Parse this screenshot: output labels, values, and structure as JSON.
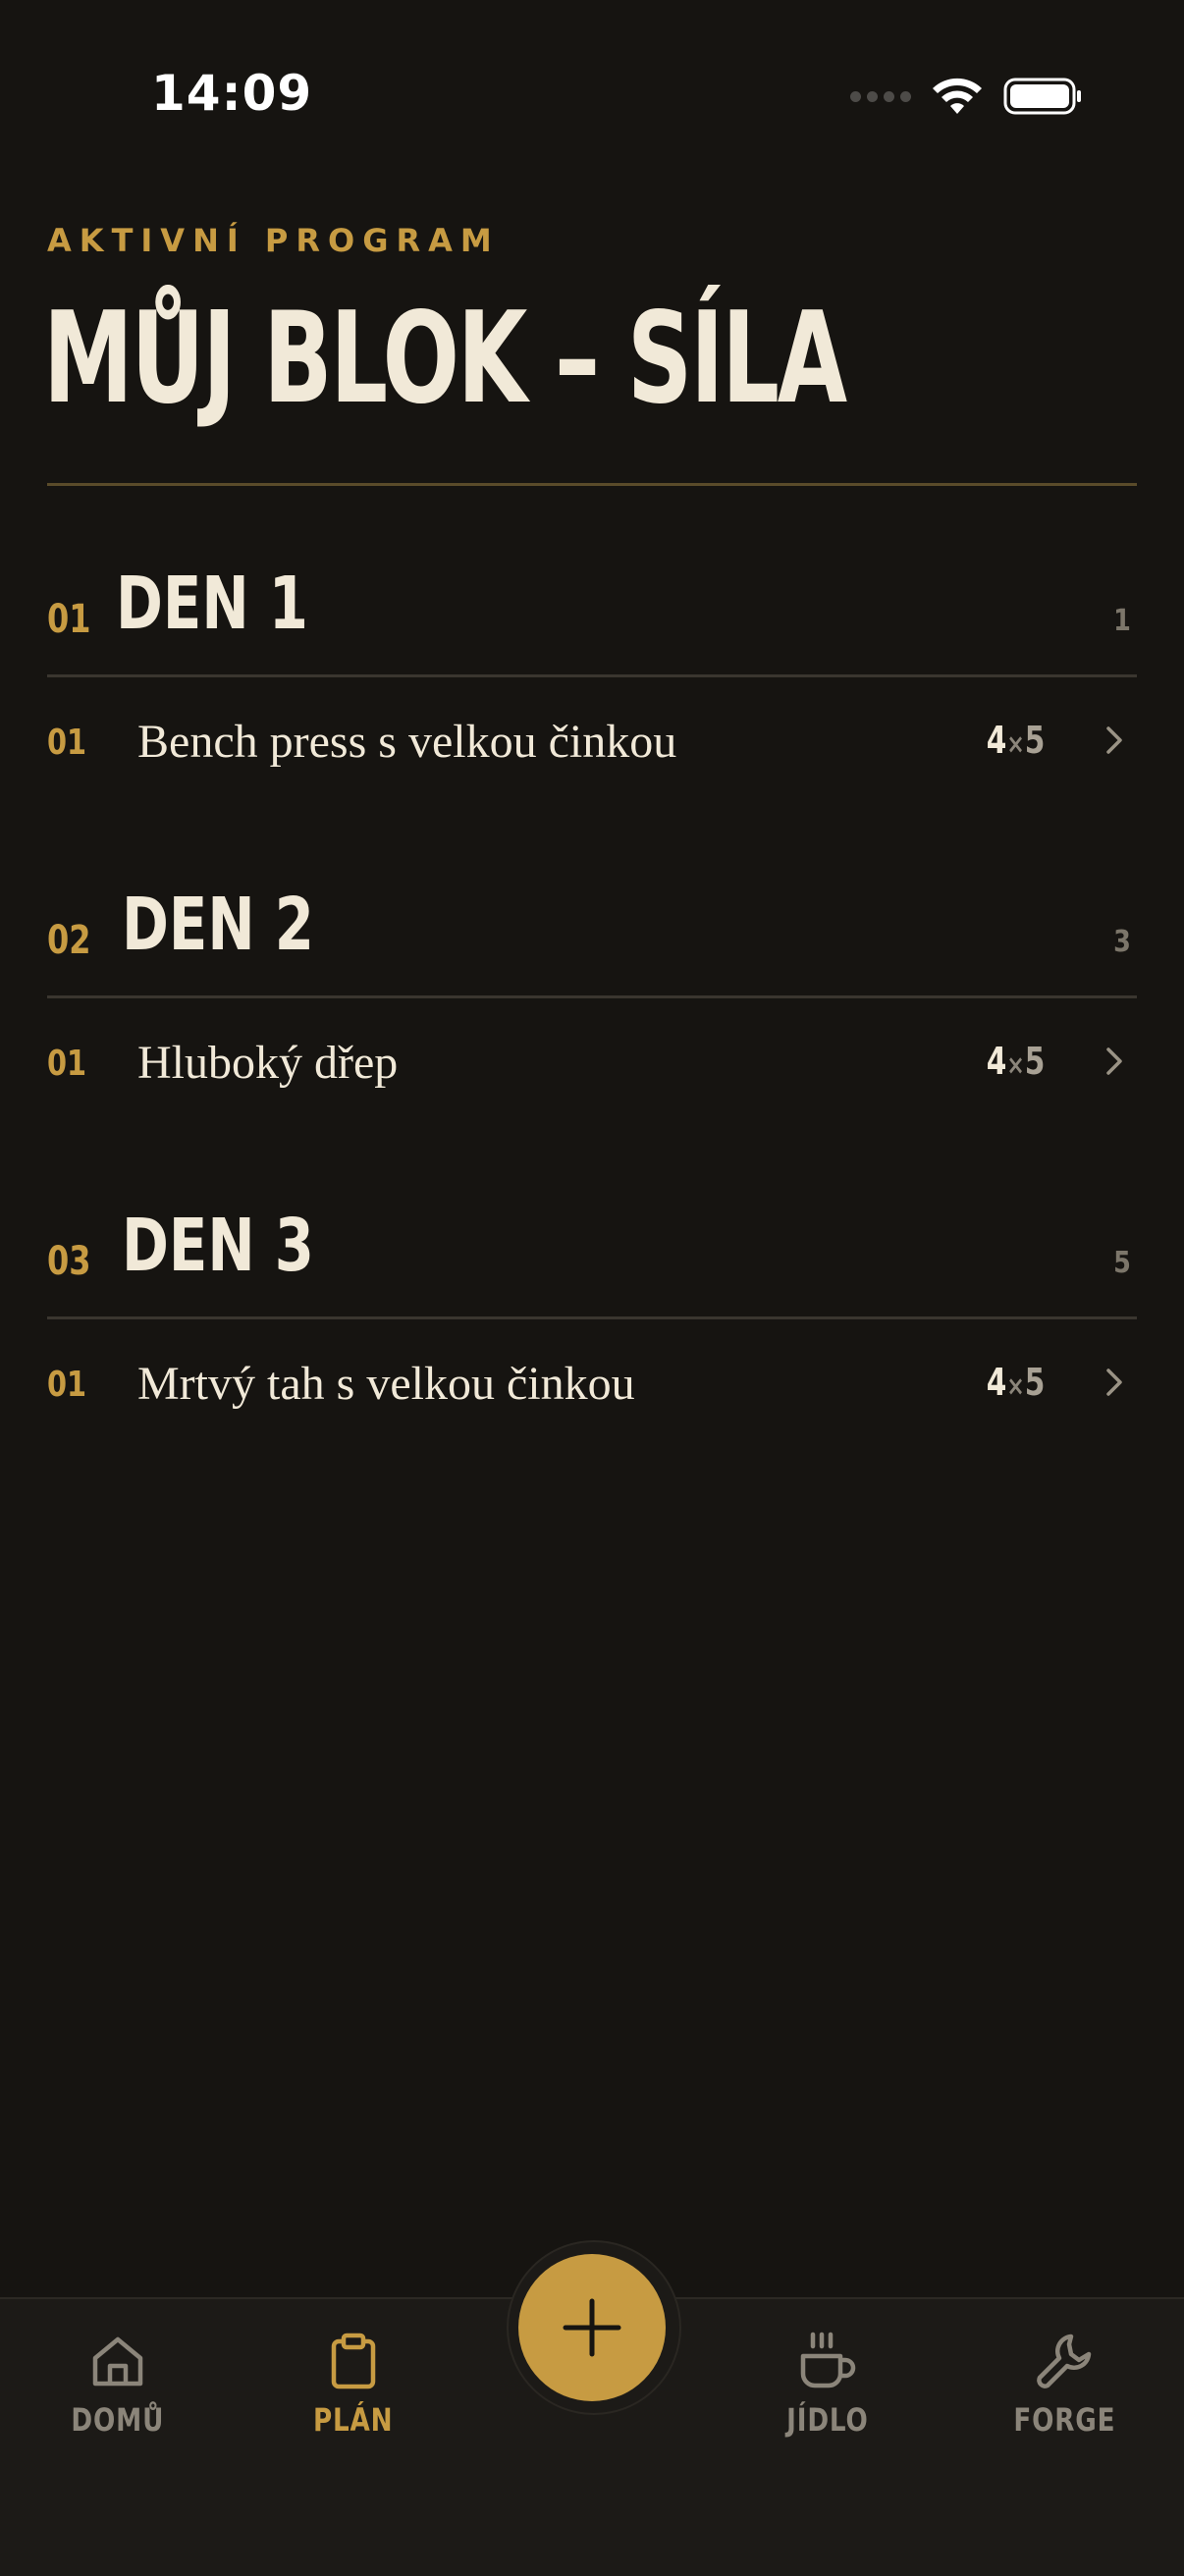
{
  "status_bar": {
    "time": "14:09",
    "icons": [
      "cellular-signal-icon",
      "wifi-icon",
      "battery-icon"
    ]
  },
  "header": {
    "eyebrow": "AKTIVNÍ PROGRAM",
    "title": "MŮJ BLOK – SÍLA"
  },
  "days": [
    {
      "number": "01",
      "title": "DEN 1",
      "count": "1",
      "exercises": [
        {
          "number": "01",
          "name": "Bench press s velkou činkou",
          "sets": "4",
          "reps": "5"
        }
      ]
    },
    {
      "number": "02",
      "title": "DEN 2",
      "count": "3",
      "exercises": [
        {
          "number": "01",
          "name": "Hluboký dřep",
          "sets": "4",
          "reps": "5"
        }
      ]
    },
    {
      "number": "03",
      "title": "DEN 3",
      "count": "5",
      "exercises": [
        {
          "number": "01",
          "name": "Mrtvý tah s velkou činkou",
          "sets": "4",
          "reps": "5"
        }
      ]
    }
  ],
  "sets_separator": "×",
  "tabbar": {
    "items": [
      {
        "label": "DOMŮ",
        "icon": "home-icon",
        "active": false
      },
      {
        "label": "PLÁN",
        "icon": "clipboard-icon",
        "active": true
      },
      {
        "label": "JÍDLO",
        "icon": "coffee-cup-icon",
        "active": false
      },
      {
        "label": "FORGE",
        "icon": "wrench-icon",
        "active": false
      }
    ],
    "fab_icon": "plus-icon"
  },
  "colors": {
    "background": "#161411",
    "accent": "#c79b42",
    "text": "#f1e9d8",
    "muted": "#7c766a",
    "tabbar": "#1c1a17"
  }
}
